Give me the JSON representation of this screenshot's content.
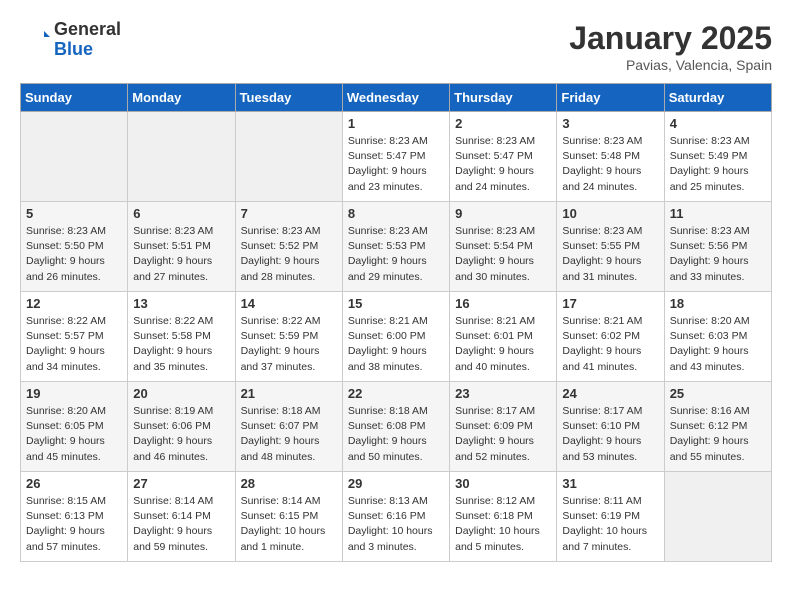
{
  "header": {
    "logo_general": "General",
    "logo_blue": "Blue",
    "title": "January 2025",
    "subtitle": "Pavias, Valencia, Spain"
  },
  "days_of_week": [
    "Sunday",
    "Monday",
    "Tuesday",
    "Wednesday",
    "Thursday",
    "Friday",
    "Saturday"
  ],
  "weeks": [
    [
      {
        "day": "",
        "info": ""
      },
      {
        "day": "",
        "info": ""
      },
      {
        "day": "",
        "info": ""
      },
      {
        "day": "1",
        "info": "Sunrise: 8:23 AM\nSunset: 5:47 PM\nDaylight: 9 hours and 23 minutes."
      },
      {
        "day": "2",
        "info": "Sunrise: 8:23 AM\nSunset: 5:47 PM\nDaylight: 9 hours and 24 minutes."
      },
      {
        "day": "3",
        "info": "Sunrise: 8:23 AM\nSunset: 5:48 PM\nDaylight: 9 hours and 24 minutes."
      },
      {
        "day": "4",
        "info": "Sunrise: 8:23 AM\nSunset: 5:49 PM\nDaylight: 9 hours and 25 minutes."
      }
    ],
    [
      {
        "day": "5",
        "info": "Sunrise: 8:23 AM\nSunset: 5:50 PM\nDaylight: 9 hours and 26 minutes."
      },
      {
        "day": "6",
        "info": "Sunrise: 8:23 AM\nSunset: 5:51 PM\nDaylight: 9 hours and 27 minutes."
      },
      {
        "day": "7",
        "info": "Sunrise: 8:23 AM\nSunset: 5:52 PM\nDaylight: 9 hours and 28 minutes."
      },
      {
        "day": "8",
        "info": "Sunrise: 8:23 AM\nSunset: 5:53 PM\nDaylight: 9 hours and 29 minutes."
      },
      {
        "day": "9",
        "info": "Sunrise: 8:23 AM\nSunset: 5:54 PM\nDaylight: 9 hours and 30 minutes."
      },
      {
        "day": "10",
        "info": "Sunrise: 8:23 AM\nSunset: 5:55 PM\nDaylight: 9 hours and 31 minutes."
      },
      {
        "day": "11",
        "info": "Sunrise: 8:23 AM\nSunset: 5:56 PM\nDaylight: 9 hours and 33 minutes."
      }
    ],
    [
      {
        "day": "12",
        "info": "Sunrise: 8:22 AM\nSunset: 5:57 PM\nDaylight: 9 hours and 34 minutes."
      },
      {
        "day": "13",
        "info": "Sunrise: 8:22 AM\nSunset: 5:58 PM\nDaylight: 9 hours and 35 minutes."
      },
      {
        "day": "14",
        "info": "Sunrise: 8:22 AM\nSunset: 5:59 PM\nDaylight: 9 hours and 37 minutes."
      },
      {
        "day": "15",
        "info": "Sunrise: 8:21 AM\nSunset: 6:00 PM\nDaylight: 9 hours and 38 minutes."
      },
      {
        "day": "16",
        "info": "Sunrise: 8:21 AM\nSunset: 6:01 PM\nDaylight: 9 hours and 40 minutes."
      },
      {
        "day": "17",
        "info": "Sunrise: 8:21 AM\nSunset: 6:02 PM\nDaylight: 9 hours and 41 minutes."
      },
      {
        "day": "18",
        "info": "Sunrise: 8:20 AM\nSunset: 6:03 PM\nDaylight: 9 hours and 43 minutes."
      }
    ],
    [
      {
        "day": "19",
        "info": "Sunrise: 8:20 AM\nSunset: 6:05 PM\nDaylight: 9 hours and 45 minutes."
      },
      {
        "day": "20",
        "info": "Sunrise: 8:19 AM\nSunset: 6:06 PM\nDaylight: 9 hours and 46 minutes."
      },
      {
        "day": "21",
        "info": "Sunrise: 8:18 AM\nSunset: 6:07 PM\nDaylight: 9 hours and 48 minutes."
      },
      {
        "day": "22",
        "info": "Sunrise: 8:18 AM\nSunset: 6:08 PM\nDaylight: 9 hours and 50 minutes."
      },
      {
        "day": "23",
        "info": "Sunrise: 8:17 AM\nSunset: 6:09 PM\nDaylight: 9 hours and 52 minutes."
      },
      {
        "day": "24",
        "info": "Sunrise: 8:17 AM\nSunset: 6:10 PM\nDaylight: 9 hours and 53 minutes."
      },
      {
        "day": "25",
        "info": "Sunrise: 8:16 AM\nSunset: 6:12 PM\nDaylight: 9 hours and 55 minutes."
      }
    ],
    [
      {
        "day": "26",
        "info": "Sunrise: 8:15 AM\nSunset: 6:13 PM\nDaylight: 9 hours and 57 minutes."
      },
      {
        "day": "27",
        "info": "Sunrise: 8:14 AM\nSunset: 6:14 PM\nDaylight: 9 hours and 59 minutes."
      },
      {
        "day": "28",
        "info": "Sunrise: 8:14 AM\nSunset: 6:15 PM\nDaylight: 10 hours and 1 minute."
      },
      {
        "day": "29",
        "info": "Sunrise: 8:13 AM\nSunset: 6:16 PM\nDaylight: 10 hours and 3 minutes."
      },
      {
        "day": "30",
        "info": "Sunrise: 8:12 AM\nSunset: 6:18 PM\nDaylight: 10 hours and 5 minutes."
      },
      {
        "day": "31",
        "info": "Sunrise: 8:11 AM\nSunset: 6:19 PM\nDaylight: 10 hours and 7 minutes."
      },
      {
        "day": "",
        "info": ""
      }
    ]
  ]
}
